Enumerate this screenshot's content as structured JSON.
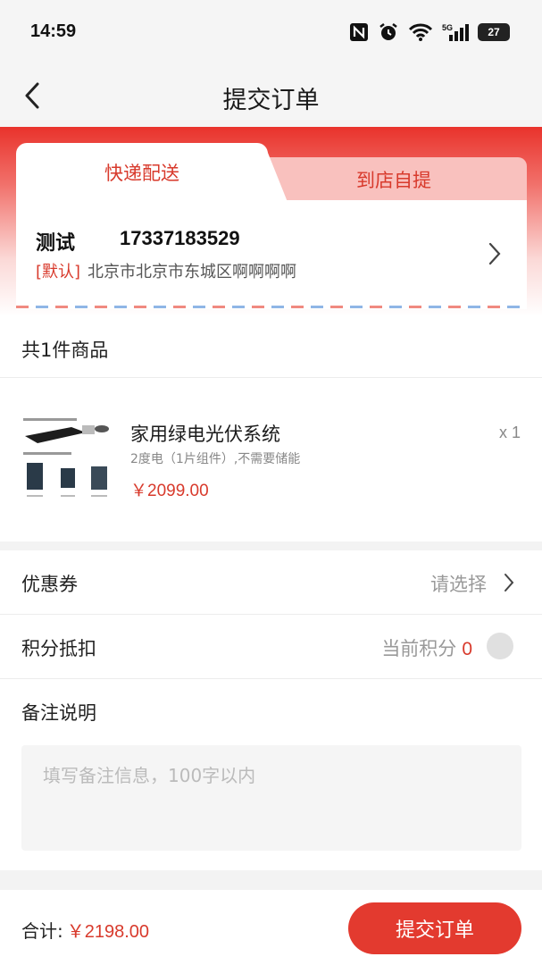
{
  "status_bar": {
    "time": "14:59",
    "battery": "27",
    "icons": [
      "nfc-icon",
      "alarm-icon",
      "wifi-icon",
      "5g-signal-icon",
      "battery-icon"
    ]
  },
  "nav": {
    "title": "提交订单",
    "back_icon": "chevron-left-icon"
  },
  "tabs": {
    "delivery": "快递配送",
    "pickup": "到店自提",
    "active": "delivery"
  },
  "address": {
    "name": "测试",
    "phone": "17337183529",
    "default_tag": "[默认]",
    "detail": "北京市北京市东城区啊啊啊啊"
  },
  "goods": {
    "count_label": "共1件商品",
    "items": [
      {
        "name": "家用绿电光伏系统",
        "spec": "2度电（1片组件）,不需要储能",
        "price": "￥2099.00",
        "qty": "x 1"
      }
    ]
  },
  "options": {
    "coupon_label": "优惠券",
    "coupon_value": "请选择",
    "points_label": "积分抵扣",
    "points_current_label": "当前积分",
    "points_value": "0",
    "points_enabled": false,
    "remark_label": "备注说明",
    "remark_placeholder": "填写备注信息，100字以内",
    "remark_value": ""
  },
  "footer": {
    "total_label": "合计:",
    "total_value": "￥2198.00",
    "submit_label": "提交订单"
  },
  "colors": {
    "accent": "#e33a2f",
    "price": "#d83a2c",
    "background": "#f3f3f3"
  }
}
